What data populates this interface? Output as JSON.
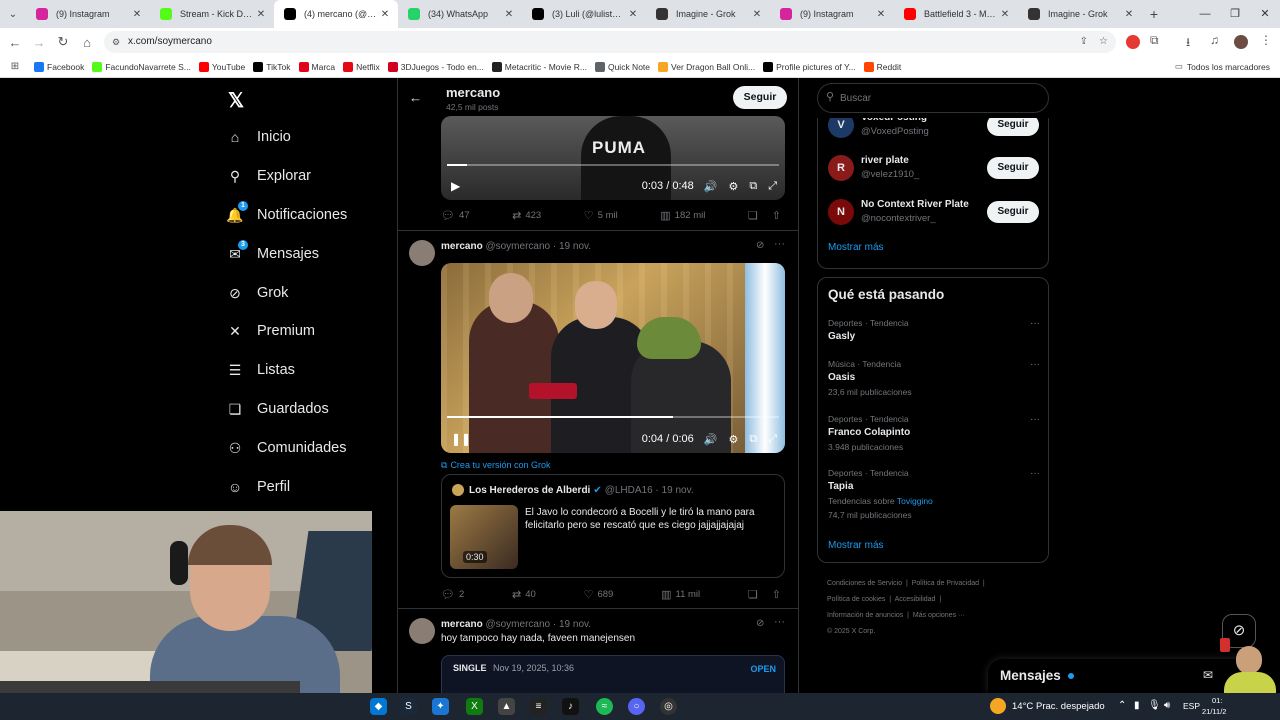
{
  "browser": {
    "tabs": [
      {
        "title": "(9) Instagram",
        "icon": "instagram-icon",
        "color": "#d6249f"
      },
      {
        "title": "Stream - Kick Dashboard",
        "icon": "kick-icon",
        "color": "#53fc18"
      },
      {
        "title": "(4) mercano (@soymercano)",
        "icon": "x-icon",
        "color": "#000000"
      },
      {
        "title": "(34) WhatsApp",
        "icon": "whatsapp-icon",
        "color": "#25d366"
      },
      {
        "title": "(3) Luli (@lulistone12)",
        "icon": "x-icon",
        "color": "#000000"
      },
      {
        "title": "Imagine - Grok",
        "icon": "grok-icon",
        "color": "#333333"
      },
      {
        "title": "(9) Instagram",
        "icon": "instagram-icon",
        "color": "#d6249f"
      },
      {
        "title": "Battlefield 3 - Multiplayer",
        "icon": "youtube-icon",
        "color": "#ff0000"
      },
      {
        "title": "Imagine - Grok",
        "icon": "grok-icon",
        "color": "#333333"
      }
    ],
    "active_tab": 2,
    "url": "x.com/soymercano",
    "bookmarks": [
      {
        "label": "Facebook",
        "color": "#1877f2"
      },
      {
        "label": "FacundoNavarrete S...",
        "color": "#53fc18"
      },
      {
        "label": "YouTube",
        "color": "#ff0000"
      },
      {
        "label": "TikTok",
        "color": "#000000"
      },
      {
        "label": "Marca",
        "color": "#e2001a"
      },
      {
        "label": "Netflix",
        "color": "#e50914"
      },
      {
        "label": "3DJuegos - Todo en...",
        "color": "#d1001c"
      },
      {
        "label": "Metacritic - Movie R...",
        "color": "#222222"
      },
      {
        "label": "Quick Note",
        "color": "#5f6368"
      },
      {
        "label": "Ver Dragon Ball Onli...",
        "color": "#f5a623"
      },
      {
        "label": "Profile pictures of Y...",
        "color": "#000000"
      },
      {
        "label": "Reddit",
        "color": "#ff4500"
      }
    ],
    "all_bookmarks": "Todos los marcadores"
  },
  "nav": {
    "items": [
      {
        "label": "Inicio",
        "icon": "home-icon",
        "glyph": "⌂"
      },
      {
        "label": "Explorar",
        "icon": "search-icon",
        "glyph": "⚲"
      },
      {
        "label": "Notificaciones",
        "icon": "bell-icon",
        "glyph": "🔔",
        "badge": "1"
      },
      {
        "label": "Mensajes",
        "icon": "mail-icon",
        "glyph": "✉",
        "badge": "3"
      },
      {
        "label": "Grok",
        "icon": "grok-icon",
        "glyph": "⊘"
      },
      {
        "label": "Premium",
        "icon": "x-premium-icon",
        "glyph": "✕"
      },
      {
        "label": "Listas",
        "icon": "list-icon",
        "glyph": "☰"
      },
      {
        "label": "Guardados",
        "icon": "bookmark-icon",
        "glyph": "❏"
      },
      {
        "label": "Comunidades",
        "icon": "communities-icon",
        "glyph": "⚇"
      },
      {
        "label": "Perfil",
        "icon": "person-icon",
        "glyph": "☺"
      }
    ]
  },
  "profile_header": {
    "name": "mercano",
    "posts": "42,5 mil posts",
    "follow": "Seguir"
  },
  "post1": {
    "time": "0:03 / 0:48",
    "progress": 0.06,
    "replies": "47",
    "reposts": "423",
    "likes": "5 mil",
    "views": "182 mil"
  },
  "post2": {
    "name": "mercano",
    "handle": "@soymercano · 19 nov.",
    "time": "0:04 / 0:06",
    "progress": 0.68,
    "grok": "Crea tu versión con Grok",
    "quote": {
      "name": "Los Herederos de Alberdi",
      "handle": "@LHDA16 · 19 nov.",
      "text": "El Javo lo condecoró a Bocelli y le tiró la mano para felicitarlo pero se rescató que es ciego jajjajjajajaj",
      "duration": "0:30"
    },
    "replies": "2",
    "reposts": "40",
    "likes": "689",
    "views": "11 mil"
  },
  "post3": {
    "name": "mercano",
    "handle": "@soymercano · 19 nov.",
    "text": "hoy tampoco hay nada, faveen manejensen",
    "card_label": "SINGLE",
    "card_date": "Nov 19, 2025, 10:36",
    "card_open": "OPEN"
  },
  "search": {
    "placeholder": "Buscar"
  },
  "follow_suggestions": [
    {
      "name": "VoxedPosting",
      "handle": "@VoxedPosting",
      "btn": "Seguir",
      "avatar_color": "#1d3a66",
      "letter": "V"
    },
    {
      "name": "river plate",
      "handle": "@velez1910_",
      "btn": "Seguir",
      "avatar_color": "#8b1a1a",
      "letter": "R"
    },
    {
      "name": "No Context River Plate",
      "handle": "@nocontextriver_",
      "btn": "Seguir",
      "avatar_color": "#7a0a0a",
      "letter": "N"
    }
  ],
  "show_more": "Mostrar más",
  "trending": {
    "title": "Qué está pasando",
    "items": [
      {
        "cat": "Deportes · Tendencia",
        "name": "Gasly",
        "count": ""
      },
      {
        "cat": "Música · Tendencia",
        "name": "Oasis",
        "count": "23,6 mil publicaciones"
      },
      {
        "cat": "Deportes · Tendencia",
        "name": "Franco Colapinto",
        "count": "3.948 publicaciones"
      },
      {
        "cat": "Deportes · Tendencia",
        "name": "Tapia",
        "count": "74,7 mil publicaciones",
        "extra": "Tendencias sobre",
        "extra_link": "Toviggino"
      }
    ],
    "show_more": "Mostrar más"
  },
  "footer": {
    "links": [
      "Condiciones de Servicio",
      "Política de Privacidad",
      "Política de cookies",
      "Accesibilidad",
      "Información de anuncios",
      "Más opciones ···"
    ],
    "copyright": "© 2025 X Corp."
  },
  "messages_drawer": {
    "title": "Mensajes"
  },
  "taskbar": {
    "weather": "14°C",
    "weather_desc": "Prac. despejado",
    "lang": "ESP",
    "time": "01:",
    "date": "21/11/2"
  }
}
